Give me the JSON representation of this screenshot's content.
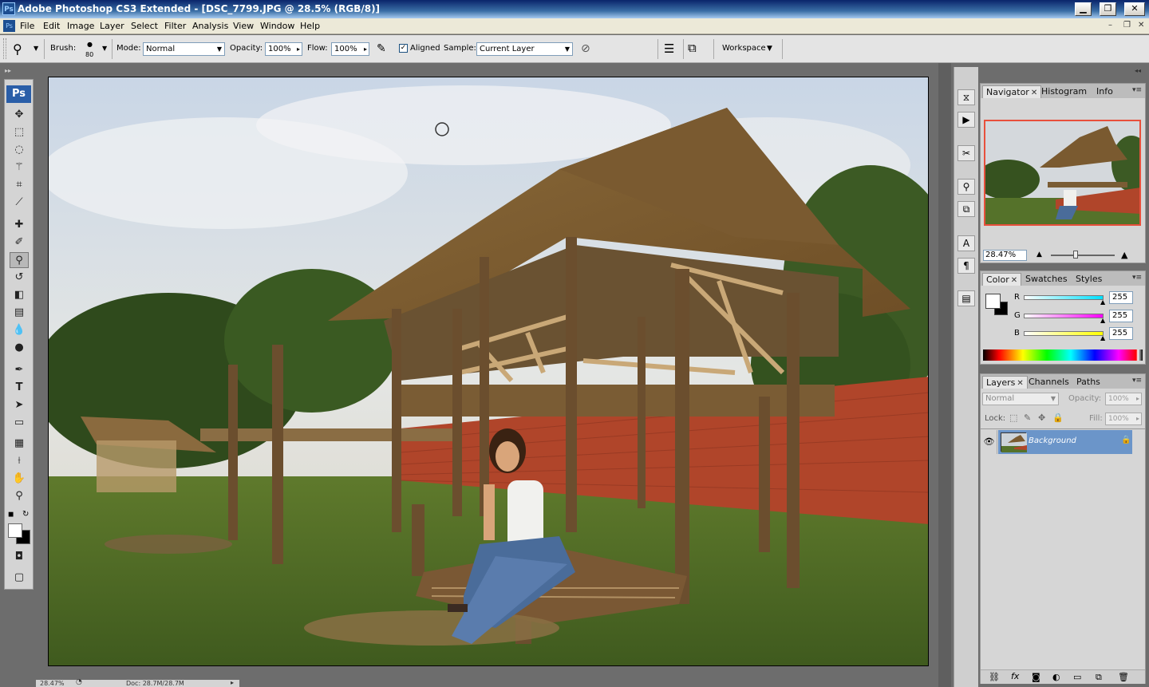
{
  "window": {
    "title": "Adobe Photoshop CS3 Extended - [DSC_7799.JPG @ 28.5% (RGB/8)]",
    "app_badge": "Ps"
  },
  "menu": [
    "File",
    "Edit",
    "Image",
    "Layer",
    "Select",
    "Filter",
    "Analysis",
    "View",
    "Window",
    "Help"
  ],
  "options": {
    "brush_label": "Brush:",
    "brush_size": "80",
    "mode_label": "Mode:",
    "mode_value": "Normal",
    "opacity_label": "Opacity:",
    "opacity_value": "100%",
    "flow_label": "Flow:",
    "flow_value": "100%",
    "aligned_label": "Aligned",
    "aligned_checked": "✓",
    "sample_label": "Sample:",
    "sample_value": "Current Layer",
    "workspace_label": "Workspace"
  },
  "toolbox": {
    "ps_button": "Ps",
    "active_tool": "clone-stamp"
  },
  "navigator": {
    "tabs": [
      "Navigator",
      "Histogram",
      "Info"
    ],
    "zoom": "28.47%",
    "frame_color": "#e8503c"
  },
  "color_panel": {
    "tabs": [
      "Color",
      "Swatches",
      "Styles"
    ],
    "channels": [
      {
        "label": "R",
        "value": "255",
        "color": "#00e0ff"
      },
      {
        "label": "G",
        "value": "255",
        "color": "#ff00ff"
      },
      {
        "label": "B",
        "value": "255",
        "color": "#ffff00"
      }
    ]
  },
  "layers_panel": {
    "tabs": [
      "Layers",
      "Channels",
      "Paths"
    ],
    "blend_mode": "Normal",
    "opacity_label": "Opacity:",
    "opacity_value": "100%",
    "lock_label": "Lock:",
    "fill_label": "Fill:",
    "fill_value": "100%",
    "layers": [
      {
        "name": "Background"
      }
    ],
    "selected_color": "#6b95c9"
  },
  "statusbar": {
    "zoom": "28.47%",
    "doc": "Doc: 28.7M/28.7M"
  }
}
